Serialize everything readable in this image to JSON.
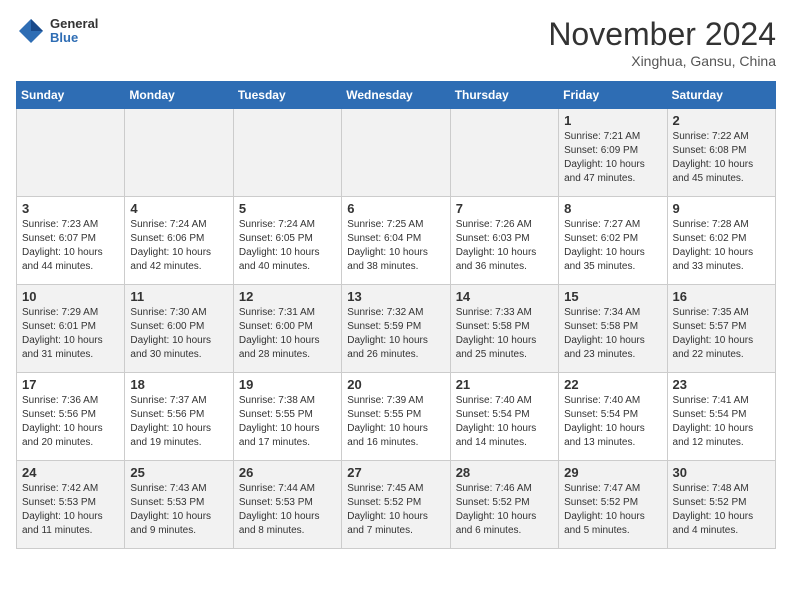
{
  "header": {
    "logo_general": "General",
    "logo_blue": "Blue",
    "month": "November 2024",
    "location": "Xinghua, Gansu, China"
  },
  "weekdays": [
    "Sunday",
    "Monday",
    "Tuesday",
    "Wednesday",
    "Thursday",
    "Friday",
    "Saturday"
  ],
  "weeks": [
    [
      {
        "day": "",
        "sunrise": "",
        "sunset": "",
        "daylight": ""
      },
      {
        "day": "",
        "sunrise": "",
        "sunset": "",
        "daylight": ""
      },
      {
        "day": "",
        "sunrise": "",
        "sunset": "",
        "daylight": ""
      },
      {
        "day": "",
        "sunrise": "",
        "sunset": "",
        "daylight": ""
      },
      {
        "day": "",
        "sunrise": "",
        "sunset": "",
        "daylight": ""
      },
      {
        "day": "1",
        "sunrise": "Sunrise: 7:21 AM",
        "sunset": "Sunset: 6:09 PM",
        "daylight": "Daylight: 10 hours and 47 minutes."
      },
      {
        "day": "2",
        "sunrise": "Sunrise: 7:22 AM",
        "sunset": "Sunset: 6:08 PM",
        "daylight": "Daylight: 10 hours and 45 minutes."
      }
    ],
    [
      {
        "day": "3",
        "sunrise": "Sunrise: 7:23 AM",
        "sunset": "Sunset: 6:07 PM",
        "daylight": "Daylight: 10 hours and 44 minutes."
      },
      {
        "day": "4",
        "sunrise": "Sunrise: 7:24 AM",
        "sunset": "Sunset: 6:06 PM",
        "daylight": "Daylight: 10 hours and 42 minutes."
      },
      {
        "day": "5",
        "sunrise": "Sunrise: 7:24 AM",
        "sunset": "Sunset: 6:05 PM",
        "daylight": "Daylight: 10 hours and 40 minutes."
      },
      {
        "day": "6",
        "sunrise": "Sunrise: 7:25 AM",
        "sunset": "Sunset: 6:04 PM",
        "daylight": "Daylight: 10 hours and 38 minutes."
      },
      {
        "day": "7",
        "sunrise": "Sunrise: 7:26 AM",
        "sunset": "Sunset: 6:03 PM",
        "daylight": "Daylight: 10 hours and 36 minutes."
      },
      {
        "day": "8",
        "sunrise": "Sunrise: 7:27 AM",
        "sunset": "Sunset: 6:02 PM",
        "daylight": "Daylight: 10 hours and 35 minutes."
      },
      {
        "day": "9",
        "sunrise": "Sunrise: 7:28 AM",
        "sunset": "Sunset: 6:02 PM",
        "daylight": "Daylight: 10 hours and 33 minutes."
      }
    ],
    [
      {
        "day": "10",
        "sunrise": "Sunrise: 7:29 AM",
        "sunset": "Sunset: 6:01 PM",
        "daylight": "Daylight: 10 hours and 31 minutes."
      },
      {
        "day": "11",
        "sunrise": "Sunrise: 7:30 AM",
        "sunset": "Sunset: 6:00 PM",
        "daylight": "Daylight: 10 hours and 30 minutes."
      },
      {
        "day": "12",
        "sunrise": "Sunrise: 7:31 AM",
        "sunset": "Sunset: 6:00 PM",
        "daylight": "Daylight: 10 hours and 28 minutes."
      },
      {
        "day": "13",
        "sunrise": "Sunrise: 7:32 AM",
        "sunset": "Sunset: 5:59 PM",
        "daylight": "Daylight: 10 hours and 26 minutes."
      },
      {
        "day": "14",
        "sunrise": "Sunrise: 7:33 AM",
        "sunset": "Sunset: 5:58 PM",
        "daylight": "Daylight: 10 hours and 25 minutes."
      },
      {
        "day": "15",
        "sunrise": "Sunrise: 7:34 AM",
        "sunset": "Sunset: 5:58 PM",
        "daylight": "Daylight: 10 hours and 23 minutes."
      },
      {
        "day": "16",
        "sunrise": "Sunrise: 7:35 AM",
        "sunset": "Sunset: 5:57 PM",
        "daylight": "Daylight: 10 hours and 22 minutes."
      }
    ],
    [
      {
        "day": "17",
        "sunrise": "Sunrise: 7:36 AM",
        "sunset": "Sunset: 5:56 PM",
        "daylight": "Daylight: 10 hours and 20 minutes."
      },
      {
        "day": "18",
        "sunrise": "Sunrise: 7:37 AM",
        "sunset": "Sunset: 5:56 PM",
        "daylight": "Daylight: 10 hours and 19 minutes."
      },
      {
        "day": "19",
        "sunrise": "Sunrise: 7:38 AM",
        "sunset": "Sunset: 5:55 PM",
        "daylight": "Daylight: 10 hours and 17 minutes."
      },
      {
        "day": "20",
        "sunrise": "Sunrise: 7:39 AM",
        "sunset": "Sunset: 5:55 PM",
        "daylight": "Daylight: 10 hours and 16 minutes."
      },
      {
        "day": "21",
        "sunrise": "Sunrise: 7:40 AM",
        "sunset": "Sunset: 5:54 PM",
        "daylight": "Daylight: 10 hours and 14 minutes."
      },
      {
        "day": "22",
        "sunrise": "Sunrise: 7:40 AM",
        "sunset": "Sunset: 5:54 PM",
        "daylight": "Daylight: 10 hours and 13 minutes."
      },
      {
        "day": "23",
        "sunrise": "Sunrise: 7:41 AM",
        "sunset": "Sunset: 5:54 PM",
        "daylight": "Daylight: 10 hours and 12 minutes."
      }
    ],
    [
      {
        "day": "24",
        "sunrise": "Sunrise: 7:42 AM",
        "sunset": "Sunset: 5:53 PM",
        "daylight": "Daylight: 10 hours and 11 minutes."
      },
      {
        "day": "25",
        "sunrise": "Sunrise: 7:43 AM",
        "sunset": "Sunset: 5:53 PM",
        "daylight": "Daylight: 10 hours and 9 minutes."
      },
      {
        "day": "26",
        "sunrise": "Sunrise: 7:44 AM",
        "sunset": "Sunset: 5:53 PM",
        "daylight": "Daylight: 10 hours and 8 minutes."
      },
      {
        "day": "27",
        "sunrise": "Sunrise: 7:45 AM",
        "sunset": "Sunset: 5:52 PM",
        "daylight": "Daylight: 10 hours and 7 minutes."
      },
      {
        "day": "28",
        "sunrise": "Sunrise: 7:46 AM",
        "sunset": "Sunset: 5:52 PM",
        "daylight": "Daylight: 10 hours and 6 minutes."
      },
      {
        "day": "29",
        "sunrise": "Sunrise: 7:47 AM",
        "sunset": "Sunset: 5:52 PM",
        "daylight": "Daylight: 10 hours and 5 minutes."
      },
      {
        "day": "30",
        "sunrise": "Sunrise: 7:48 AM",
        "sunset": "Sunset: 5:52 PM",
        "daylight": "Daylight: 10 hours and 4 minutes."
      }
    ]
  ]
}
